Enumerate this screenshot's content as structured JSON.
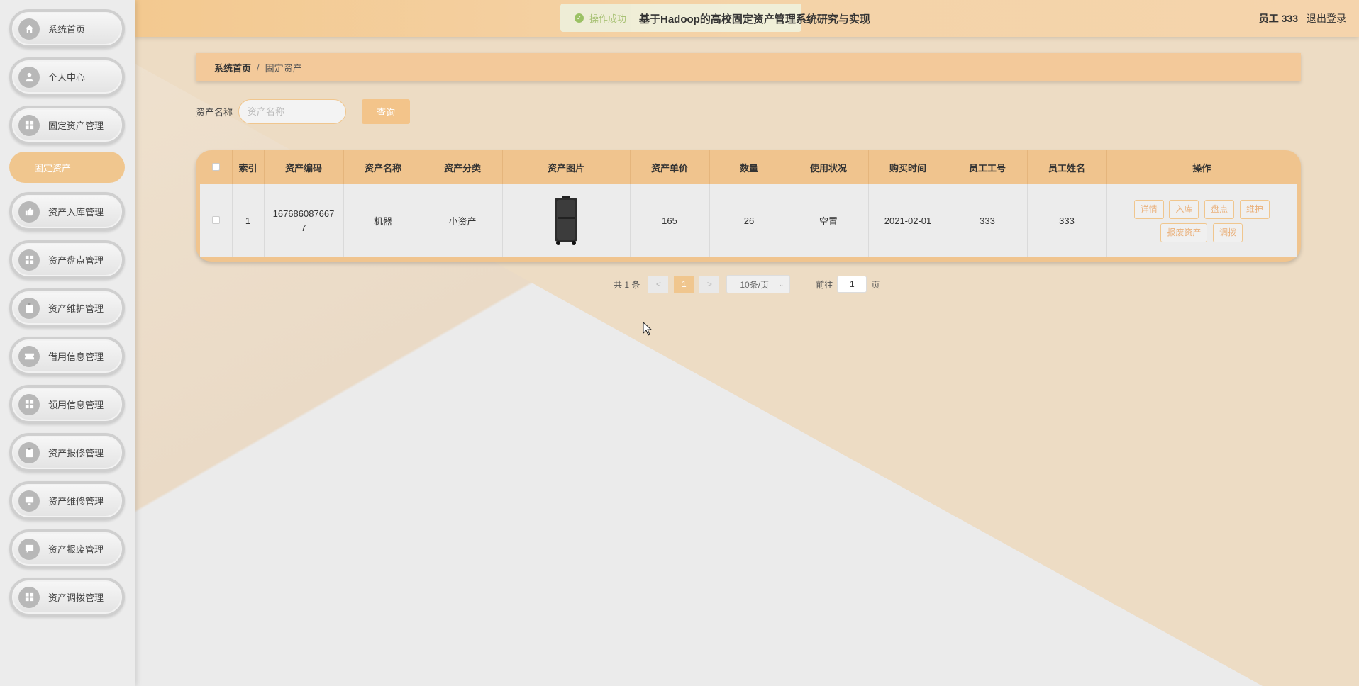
{
  "header": {
    "title": "基于Hadoop的高校固定资产管理系统研究与实现",
    "toast": "操作成功",
    "user": "员工 333",
    "logout": "退出登录"
  },
  "sidebar": {
    "items": [
      {
        "label": "系统首页",
        "icon": "home-icon"
      },
      {
        "label": "个人中心",
        "icon": "user-icon"
      },
      {
        "label": "固定资产管理",
        "icon": "grid-icon"
      },
      {
        "label": "资产入库管理",
        "icon": "thumb-icon"
      },
      {
        "label": "资产盘点管理",
        "icon": "grid-icon"
      },
      {
        "label": "资产维护管理",
        "icon": "clipboard-icon"
      },
      {
        "label": "借用信息管理",
        "icon": "ticket-icon"
      },
      {
        "label": "领用信息管理",
        "icon": "grid-icon"
      },
      {
        "label": "资产报修管理",
        "icon": "clipboard-icon"
      },
      {
        "label": "资产维修管理",
        "icon": "monitor-icon"
      },
      {
        "label": "资产报废管理",
        "icon": "chat-icon"
      },
      {
        "label": "资产调拨管理",
        "icon": "grid-icon"
      }
    ],
    "sub_item": "固定资产"
  },
  "breadcrumb": {
    "home": "系统首页",
    "sep": "/",
    "current": "固定资产"
  },
  "search": {
    "label": "资产名称",
    "placeholder": "资产名称",
    "button": "查询"
  },
  "table": {
    "headers": [
      "索引",
      "资产编码",
      "资产名称",
      "资产分类",
      "资产图片",
      "资产单价",
      "数量",
      "使用状况",
      "购买时间",
      "员工工号",
      "员工姓名",
      "操作"
    ],
    "rows": [
      {
        "index": "1",
        "code": "1676860876677",
        "name": "机器",
        "category": "小资产",
        "price": "165",
        "qty": "26",
        "status": "空置",
        "date": "2021-02-01",
        "emp_no": "333",
        "emp_name": "333"
      }
    ],
    "actions": [
      "详情",
      "入库",
      "盘点",
      "维护",
      "报废资产",
      "调拨"
    ]
  },
  "pager": {
    "total": "共 1 条",
    "prev": "<",
    "page": "1",
    "next": ">",
    "size": "10条/页",
    "goto_label": "前往",
    "goto_value": "1",
    "goto_unit": "页"
  },
  "colors": {
    "accent": "#f0c68e",
    "header": "#f4d0a2"
  }
}
